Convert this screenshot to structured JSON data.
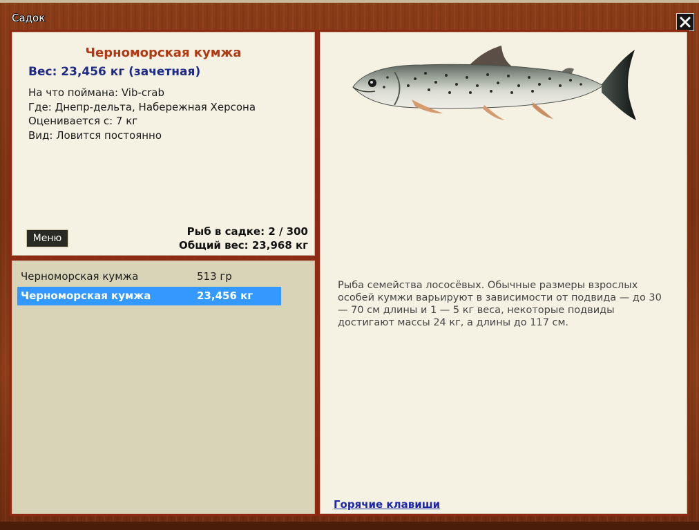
{
  "window": {
    "title": "Садок"
  },
  "info": {
    "fish_name": "Черноморская кумжа",
    "weight_line": "Вес: 23,456 кг (зачетная)",
    "lines": [
      "На что поймана: Vib-crab",
      "Где: Днепр-дельта, Набережная Херсона",
      "Оценивается с: 7 кг",
      "Вид: Ловится постоянно"
    ],
    "menu_label": "Меню",
    "count_line": "Рыб в садке: 2 / 300",
    "total_weight_line": "Общий вес: 23,968 кг"
  },
  "fish_list": [
    {
      "name": "Черноморская кумжа",
      "weight": "513 гр",
      "selected": false
    },
    {
      "name": "Черноморская кумжа",
      "weight": "23,456 кг",
      "selected": true
    }
  ],
  "detail": {
    "description": "Рыба семейства лососёвых. Обычные размеры взрослых особей кумжи варьируют в зависимости от подвида — до 30 — 70 см длины и 1 — 5 кг веса, некоторые подвиды достигают массы 24 кг, а длины до 117 см.",
    "hotkeys_label": "Горячие клавиши"
  },
  "colors": {
    "frame": "#8e2a14",
    "panel_bg": "#f6f2e3",
    "list_bg": "#d9d4b8",
    "selection": "#3399ff",
    "fish_name": "#b13a14",
    "weight": "#1d2a86",
    "link": "#1a28a8"
  },
  "icons": {
    "close": "close-icon",
    "fish": "trout-illustration"
  }
}
